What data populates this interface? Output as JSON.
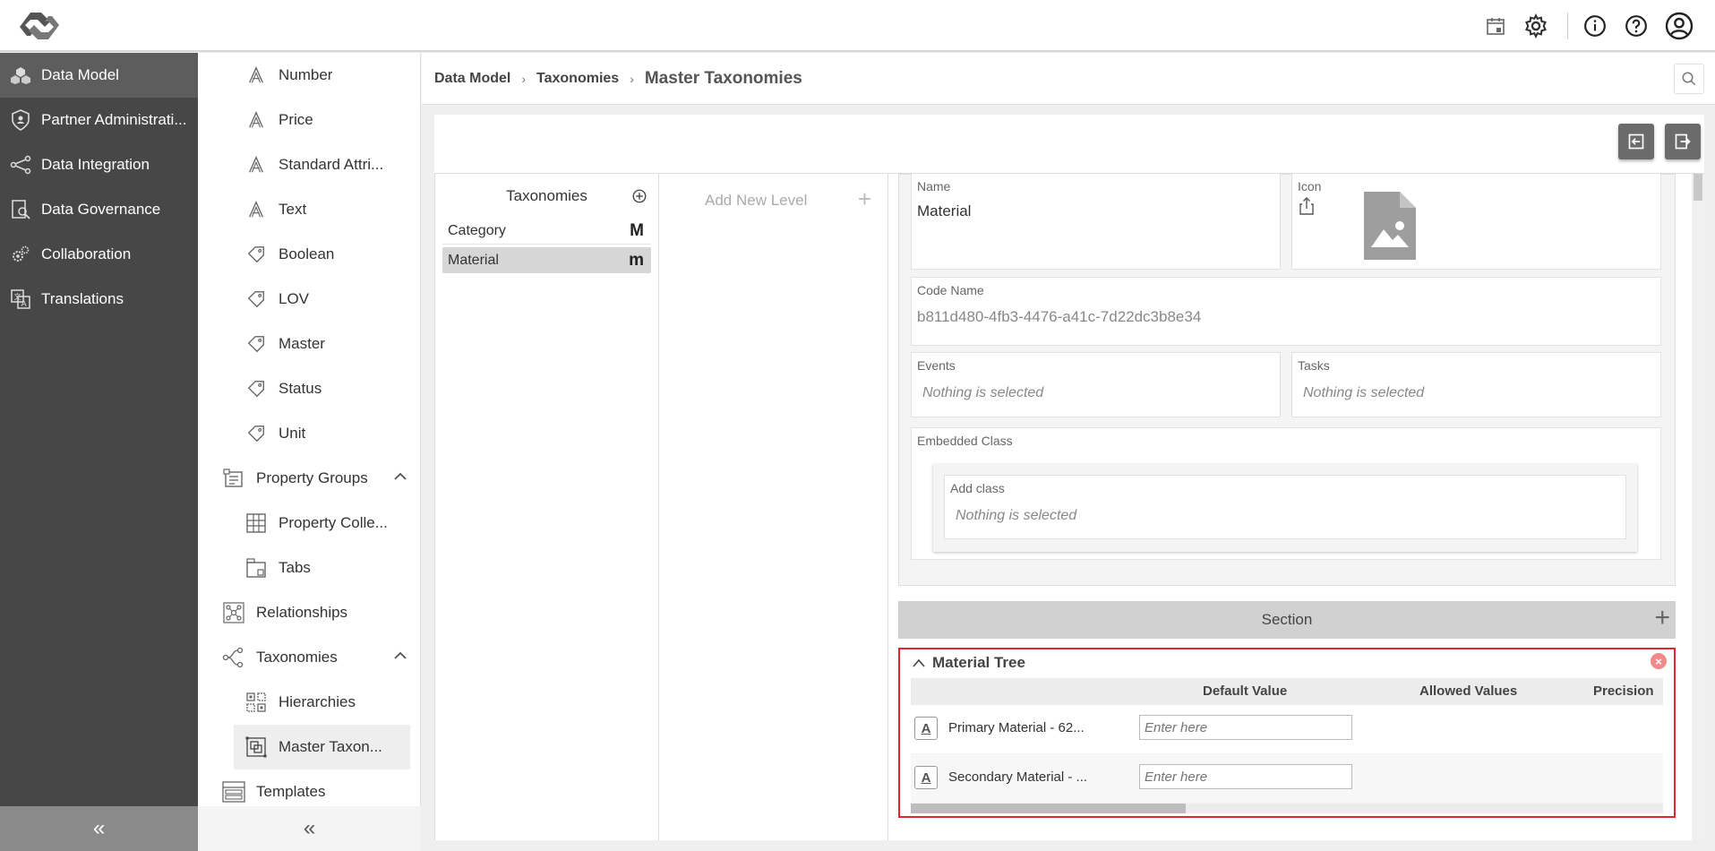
{
  "topbar": {
    "icons": [
      "logo-icon",
      "calendar-icon",
      "gear-icon",
      "info-icon",
      "help-icon",
      "user-icon"
    ]
  },
  "leftnav": {
    "items": [
      {
        "label": "Data Model",
        "icon": "cubes-icon",
        "active": true
      },
      {
        "label": "Partner Administrati...",
        "icon": "shield-icon"
      },
      {
        "label": "Data Integration",
        "icon": "share-icon"
      },
      {
        "label": "Data Governance",
        "icon": "doc-search-icon"
      },
      {
        "label": "Collaboration",
        "icon": "gears-icon"
      },
      {
        "label": "Translations",
        "icon": "translate-icon"
      }
    ],
    "collapse_label": "«"
  },
  "submenu": {
    "items": [
      {
        "label": "Number",
        "icon": "attribute-icon",
        "level": 2
      },
      {
        "label": "Price",
        "icon": "attribute-icon",
        "level": 2
      },
      {
        "label": "Standard Attri...",
        "icon": "attribute-icon",
        "level": 2
      },
      {
        "label": "Text",
        "icon": "attribute-icon",
        "level": 2
      },
      {
        "label": "Boolean",
        "icon": "tag-icon",
        "level": 2
      },
      {
        "label": "LOV",
        "icon": "tag-icon",
        "level": 2
      },
      {
        "label": "Master",
        "icon": "tag-icon",
        "level": 2
      },
      {
        "label": "Status",
        "icon": "tag-icon",
        "level": 2
      },
      {
        "label": "Unit",
        "icon": "tag-icon",
        "level": 2
      },
      {
        "label": "Property Groups",
        "icon": "property-groups-icon",
        "level": 1,
        "expanded": true
      },
      {
        "label": "Property Colle...",
        "icon": "grid-icon",
        "level": 2
      },
      {
        "label": "Tabs",
        "icon": "tabs-icon",
        "level": 2
      },
      {
        "label": "Relationships",
        "icon": "relationships-icon",
        "level": 1
      },
      {
        "label": "Taxonomies",
        "icon": "taxonomies-icon",
        "level": 1,
        "expanded": true
      },
      {
        "label": "Hierarchies",
        "icon": "hierarchies-icon",
        "level": 2
      },
      {
        "label": "Master Taxon...",
        "icon": "master-taxonomy-icon",
        "level": 2,
        "selected": true
      },
      {
        "label": "Templates",
        "icon": "templates-icon",
        "level": 1
      }
    ],
    "collapse_label": "«"
  },
  "breadcrumb": {
    "items": [
      "Data Model",
      "Taxonomies"
    ],
    "current": "Master Taxonomies"
  },
  "taxonomies": {
    "title": "Taxonomies",
    "rows": [
      {
        "label": "Category",
        "badge": "M"
      },
      {
        "label": "Material",
        "badge": "m",
        "selected": true
      }
    ]
  },
  "levels": {
    "add_label": "Add New Level"
  },
  "details": {
    "name_label": "Name",
    "name_value": "Material",
    "icon_label": "Icon",
    "code_name_label": "Code Name",
    "code_name_value": "b811d480-4fb3-4476-a41c-7d22dc3b8e34",
    "events_label": "Events",
    "events_value": "Nothing is selected",
    "tasks_label": "Tasks",
    "tasks_value": "Nothing is selected",
    "embedded_label": "Embedded Class",
    "add_class_label": "Add class",
    "add_class_value": "Nothing is selected"
  },
  "section": {
    "label": "Section",
    "tree_title": "Material Tree",
    "columns": [
      "Default Value",
      "Allowed Values",
      "Precision"
    ],
    "rows": [
      {
        "name": "Primary Material - 62...",
        "placeholder": "Enter here"
      },
      {
        "name": "Secondary Material - ...",
        "placeholder": "Enter here"
      }
    ]
  },
  "colors": {
    "nav_bg": "#474747",
    "highlight_red": "#e0262e"
  }
}
